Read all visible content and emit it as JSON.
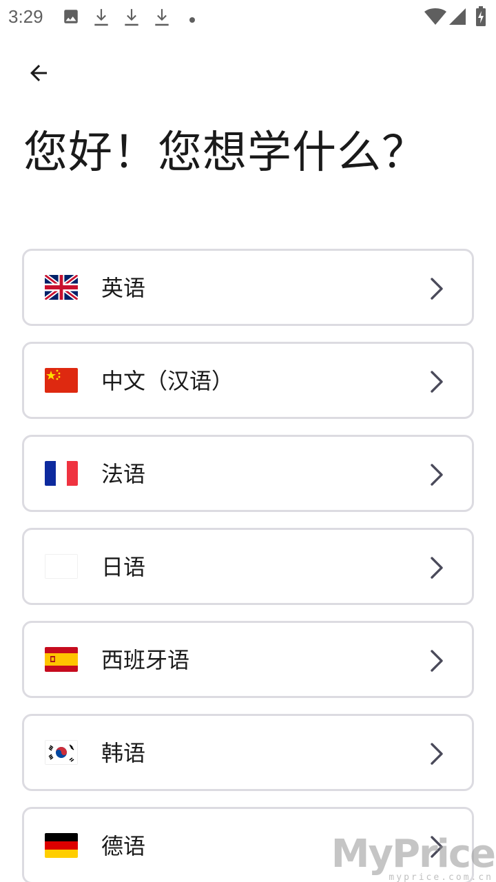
{
  "status_bar": {
    "time": "3:29",
    "icons": [
      "image-icon",
      "download-icon",
      "download-icon",
      "download-icon",
      "dot-icon",
      "wifi-icon",
      "signal-icon",
      "battery-charging-icon"
    ]
  },
  "header": {
    "back_icon": "arrow-left-icon",
    "title": "您好！您想学什么？"
  },
  "languages": [
    {
      "label": "英语",
      "flag": "uk-flag-icon"
    },
    {
      "label": "中文（汉语）",
      "flag": "china-flag-icon"
    },
    {
      "label": "法语",
      "flag": "france-flag-icon"
    },
    {
      "label": "日语",
      "flag": "japan-flag-icon"
    },
    {
      "label": "西班牙语",
      "flag": "spain-flag-icon"
    },
    {
      "label": "韩语",
      "flag": "korea-flag-icon"
    },
    {
      "label": "德语",
      "flag": "germany-flag-icon"
    }
  ],
  "watermark": {
    "main": "MyPrice",
    "sub": "myprice.com.cn"
  },
  "colors": {
    "border": "#dcdbe1",
    "text": "#1a1a1a",
    "chevron": "#4a4a5a"
  }
}
